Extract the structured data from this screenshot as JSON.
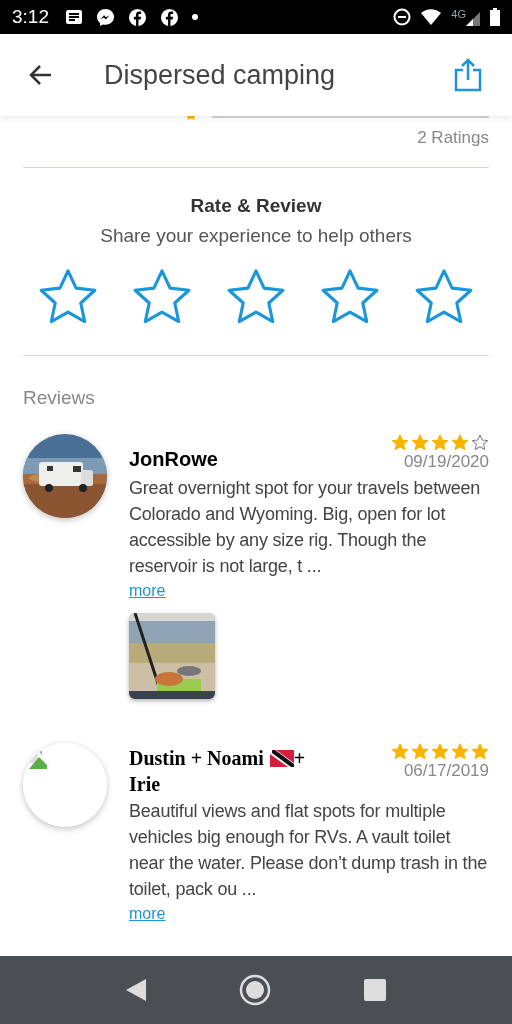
{
  "status_bar": {
    "time": "3:12",
    "network": "4G"
  },
  "app_bar": {
    "title": "Dispersed camping"
  },
  "ratings_summary": {
    "count": "2 Ratings"
  },
  "rate_review": {
    "title": "Rate & Review",
    "subtitle": "Share your experience to help others",
    "stars": 0
  },
  "reviews_heading": "Reviews",
  "reviews": [
    {
      "avatar": {
        "kind": "picture"
      },
      "name": "JonRowe",
      "stars": 4,
      "date": "09/19/2020",
      "text": "Great overnight spot for your travels between Colorado and Wyoming. Big, open for lot accessible by any size rig. Though the reservoir is not large, t ...",
      "more": "more",
      "photos": [
        {
          "kind": "picture"
        }
      ]
    },
    {
      "avatar": {
        "kind": "broken_image"
      },
      "name": "Dustin + Noami",
      "name_suffix": "+",
      "name_line2": "Irie",
      "stars": 5,
      "date": "06/17/2019",
      "text": "Beautiful views and flat spots for multiple vehicles big enough for RVs. A vault toilet near the water. Please don’t dump trash in the toilet, pack ou ...",
      "more": "more"
    }
  ]
}
